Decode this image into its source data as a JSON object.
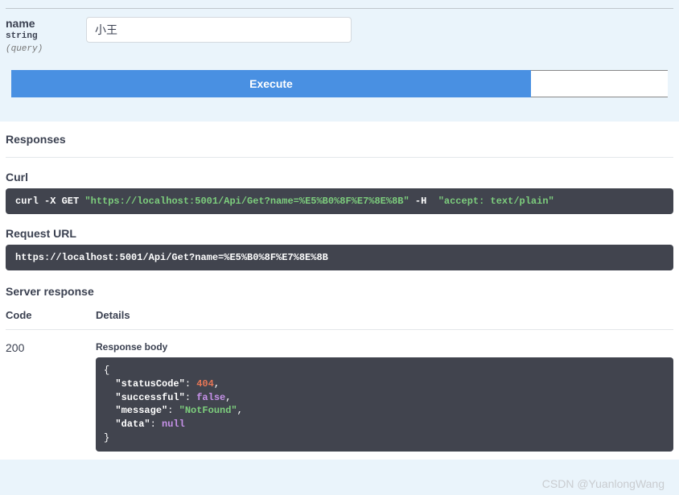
{
  "param": {
    "name": "name",
    "type": "string",
    "location": "(query)",
    "value": "小王"
  },
  "buttons": {
    "execute": "Execute"
  },
  "responses": {
    "title": "Responses",
    "curl_label": "Curl",
    "curl": {
      "prefix": "curl -X GET ",
      "url": "\"https://localhost:5001/Api/Get?name=%E5%B0%8F%E7%8E%8B\"",
      "h_flag": " -H  ",
      "header": "\"accept: text/plain\""
    },
    "request_url_label": "Request URL",
    "request_url": "https://localhost:5001/Api/Get?name=%E5%B0%8F%E7%8E%8B",
    "server_response_label": "Server response",
    "columns": {
      "code": "Code",
      "details": "Details"
    },
    "row": {
      "code": "200",
      "body_label": "Response body",
      "json": {
        "statusCode": 404,
        "successful": false,
        "message": "NotFound",
        "data": null
      }
    }
  },
  "watermark": "CSDN @YuanlongWang"
}
